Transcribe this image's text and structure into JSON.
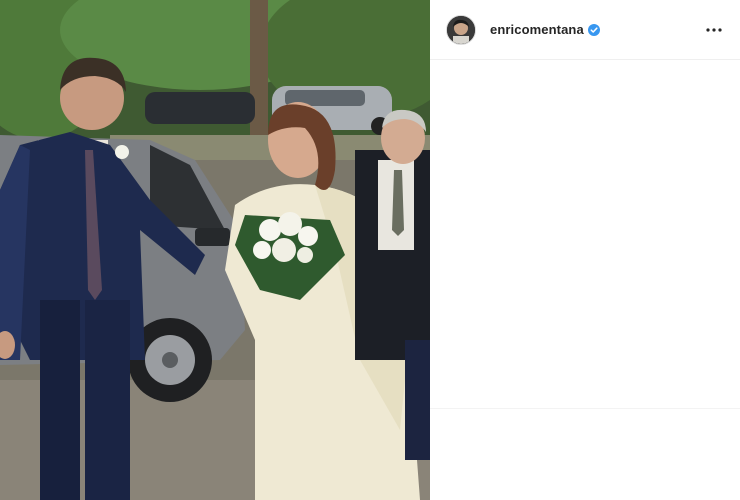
{
  "post": {
    "username": "enricomentana",
    "verified": true,
    "photo_alt": "",
    "icons": {
      "verified": "verified-badge-icon",
      "more": "more-options-icon"
    }
  },
  "colors": {
    "username": "#262626",
    "verified_blue": "#3897f0",
    "divider": "#efefef"
  }
}
